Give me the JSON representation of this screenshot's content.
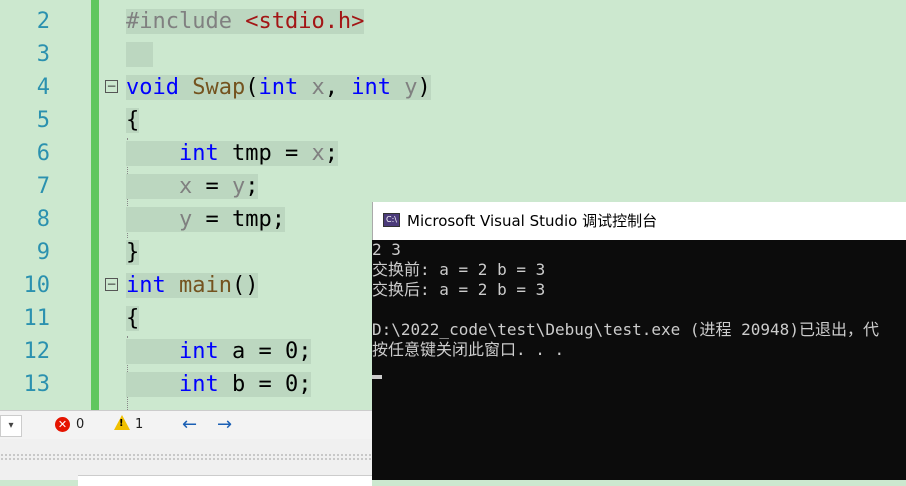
{
  "editor": {
    "lines": [
      {
        "num": "2",
        "tokens": [
          {
            "t": "#include ",
            "c": "pp"
          },
          {
            "t": "<stdio.h>",
            "c": "str"
          }
        ]
      },
      {
        "num": "3",
        "tokens": []
      },
      {
        "num": "4",
        "fold": "−",
        "tokens": [
          {
            "t": "void",
            "c": "kw"
          },
          {
            "t": " "
          },
          {
            "t": "Swap",
            "c": "fn"
          },
          {
            "t": "("
          },
          {
            "t": "int",
            "c": "kw"
          },
          {
            "t": " "
          },
          {
            "t": "x",
            "c": "par"
          },
          {
            "t": ", "
          },
          {
            "t": "int",
            "c": "kw"
          },
          {
            "t": " "
          },
          {
            "t": "y",
            "c": "par"
          },
          {
            "t": ")"
          }
        ]
      },
      {
        "num": "5",
        "tokens": [
          {
            "t": "{"
          }
        ]
      },
      {
        "num": "6",
        "tokens": [
          {
            "t": "    "
          },
          {
            "t": "int",
            "c": "kw"
          },
          {
            "t": " tmp = "
          },
          {
            "t": "x",
            "c": "par"
          },
          {
            "t": ";"
          }
        ]
      },
      {
        "num": "7",
        "tokens": [
          {
            "t": "    "
          },
          {
            "t": "x",
            "c": "par"
          },
          {
            "t": " = "
          },
          {
            "t": "y",
            "c": "par"
          },
          {
            "t": ";"
          }
        ]
      },
      {
        "num": "8",
        "tokens": [
          {
            "t": "    "
          },
          {
            "t": "y",
            "c": "par"
          },
          {
            "t": " = tmp;"
          }
        ]
      },
      {
        "num": "9",
        "tokens": [
          {
            "t": "}"
          }
        ]
      },
      {
        "num": "10",
        "fold": "−",
        "tokens": [
          {
            "t": "int",
            "c": "kw"
          },
          {
            "t": " "
          },
          {
            "t": "main",
            "c": "fn"
          },
          {
            "t": "()"
          }
        ]
      },
      {
        "num": "11",
        "tokens": [
          {
            "t": "{"
          }
        ]
      },
      {
        "num": "12",
        "tokens": [
          {
            "t": "    "
          },
          {
            "t": "int",
            "c": "kw"
          },
          {
            "t": " a = 0;"
          }
        ]
      },
      {
        "num": "13",
        "tokens": [
          {
            "t": "    "
          },
          {
            "t": "int",
            "c": "kw"
          },
          {
            "t": " b = 0;"
          }
        ]
      }
    ]
  },
  "status": {
    "errors": "0",
    "warnings": "1",
    "error_icon": "error-icon",
    "warning_icon": "warning-icon",
    "back_arrow": "←",
    "forward_arrow": "→",
    "dropdown": "▾"
  },
  "console": {
    "title": "Microsoft Visual Studio 调试控制台",
    "icon_label": "C:\\",
    "lines": [
      "2 3",
      "交换前: a = 2 b = 3",
      "交换后: a = 2 b = 3",
      "",
      "D:\\2022_code\\test\\Debug\\test.exe (进程 20948)已退出，代",
      "按任意键关闭此窗口. . ."
    ]
  }
}
